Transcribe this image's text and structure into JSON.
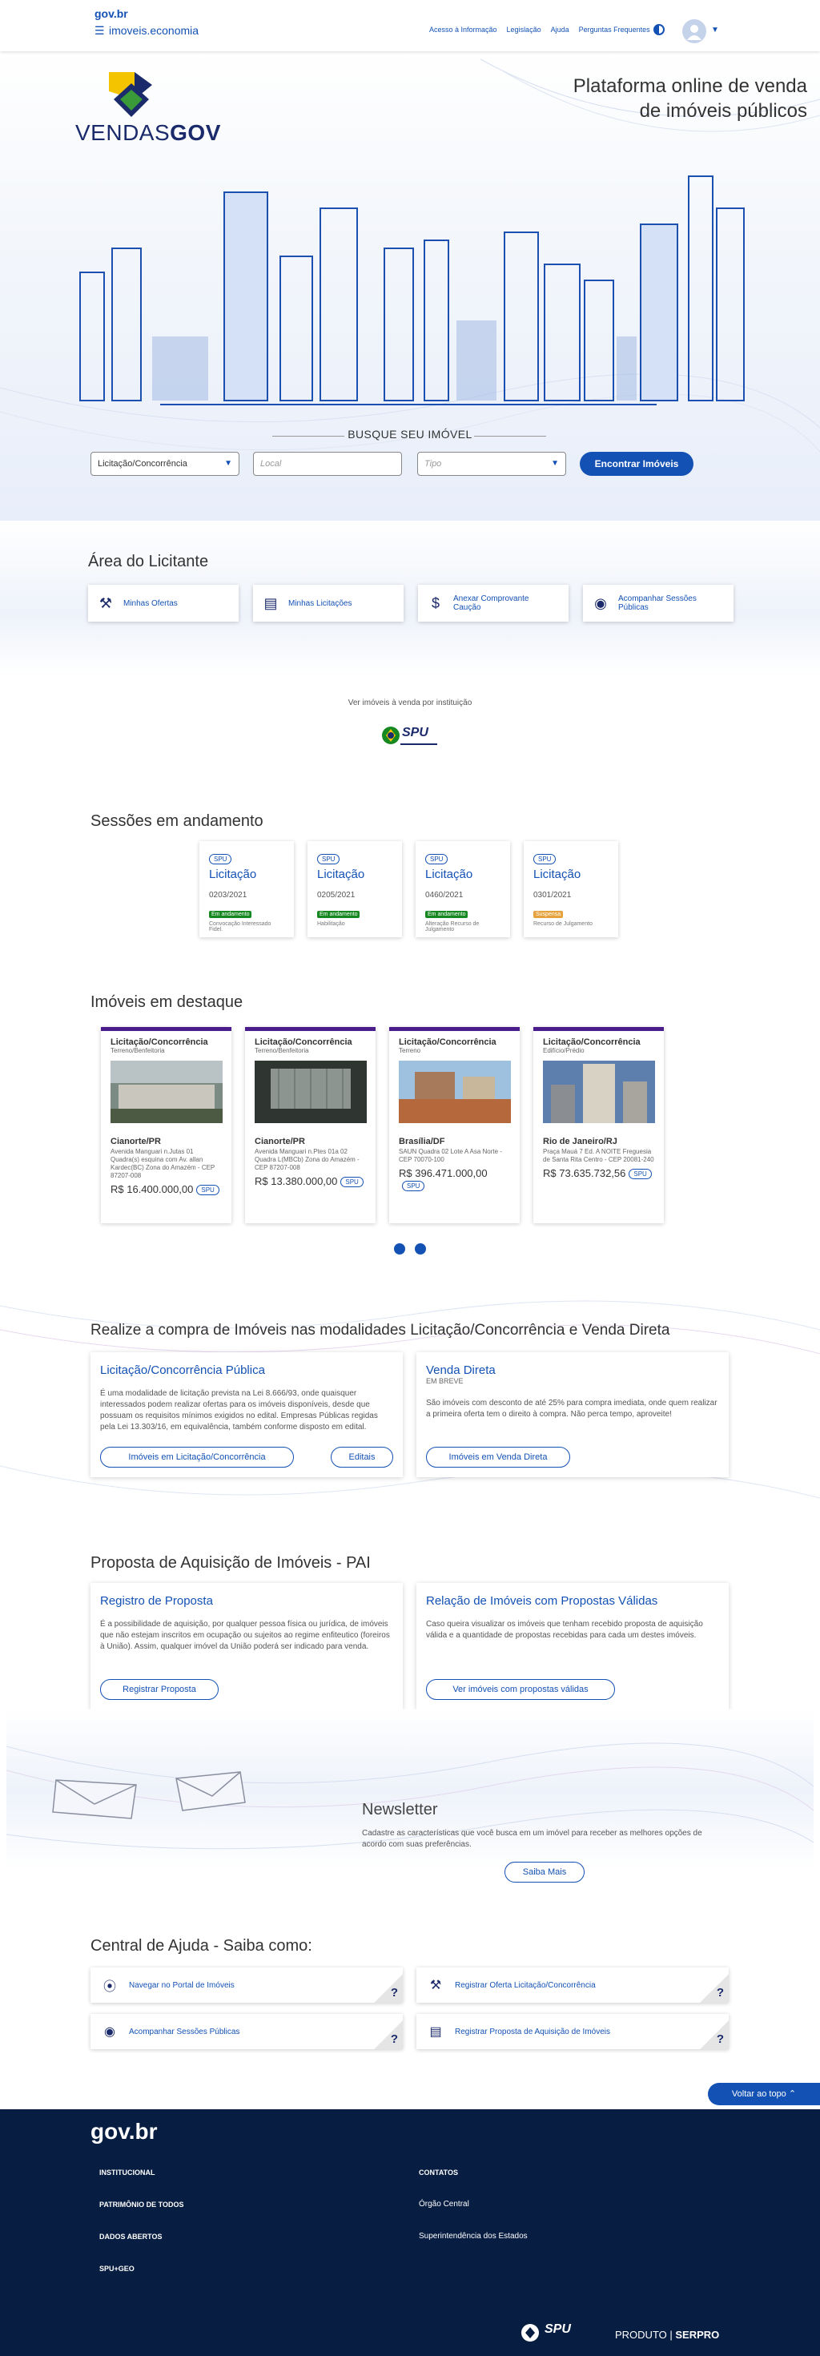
{
  "header": {
    "govbr": "gov.br",
    "site_name": "imoveis.economia",
    "links": [
      "Acesso à Informação",
      "Legislação",
      "Ajuda",
      "Perguntas Frequentes"
    ]
  },
  "hero": {
    "logo_text_1": "VENDAS",
    "logo_text_2": "GOV",
    "title_line1": "Plataforma online de venda",
    "title_line2": "de imóveis públicos"
  },
  "search": {
    "title": "BUSQUE SEU IMÓVEL",
    "modality_value": "Licitação/Concorrência",
    "local_placeholder": "Local",
    "type_placeholder": "Tipo",
    "button": "Encontrar Imóveis"
  },
  "licitante": {
    "title": "Área do Licitante",
    "items": [
      {
        "label": "Minhas Ofertas",
        "icon": "gavel-icon"
      },
      {
        "label": "Minhas Licitações",
        "icon": "clipboard-icon"
      },
      {
        "label": "Anexar Comprovante Caução",
        "icon": "invoice-icon"
      },
      {
        "label": "Acompanhar Sessões Públicas",
        "icon": "eye-icon"
      }
    ]
  },
  "institution": {
    "label": "Ver imóveis à venda por instituição",
    "logo": "SPU"
  },
  "sessions": {
    "title": "Sessões em andamento",
    "items": [
      {
        "org": "SPU",
        "type": "Licitação",
        "number": "0203/2021",
        "badge": "Em andamento",
        "badge_color": "#168821",
        "status": "Convocação Interessado Fidel."
      },
      {
        "org": "SPU",
        "type": "Licitação",
        "number": "0205/2021",
        "badge": "Em andamento",
        "badge_color": "#168821",
        "status": "Habilitação"
      },
      {
        "org": "SPU",
        "type": "Licitação",
        "number": "0460/2021",
        "badge": "Em andamento",
        "badge_color": "#168821",
        "status": "Alteração Recurso de Julgamento"
      },
      {
        "org": "SPU",
        "type": "Licitação",
        "number": "0301/2021",
        "badge": "Suspensa",
        "badge_color": "#e6a23c",
        "status": "Recurso de Julgamento"
      }
    ]
  },
  "featured": {
    "title": "Imóveis em destaque",
    "items": [
      {
        "modality": "Licitação/Concorrência",
        "type": "Terreno/Benfeitoria",
        "city": "Cianorte/PR",
        "address": "Avenida Manguari n.Jutas 01 Quadra(s) esquina com Av. allan Kardec(BC) Zona do Amazém - CEP 87207-008",
        "price": "R$ 16.400.000,00",
        "org": "SPU"
      },
      {
        "modality": "Licitação/Concorrência",
        "type": "Terreno/Benfeitoria",
        "city": "Cianorte/PR",
        "address": "Avenida Manguari n.Ptes 01a 02 Quadra L(MBCb) Zona do Amazém - CEP 87207-008",
        "price": "R$ 13.380.000,00",
        "org": "SPU"
      },
      {
        "modality": "Licitação/Concorrência",
        "type": "Terreno",
        "city": "Brasília/DF",
        "address": "SAUN Quadra 02 Lote A Asa Norte - CEP 70070-100",
        "price": "R$ 396.471.000,00",
        "org": "SPU"
      },
      {
        "modality": "Licitação/Concorrência",
        "type": "Edifício/Prédio",
        "city": "Rio de Janeiro/RJ",
        "address": "Praça Mauá 7 Ed. A NOITE Freguesia de Santa Rita Centro - CEP 20081-240",
        "price": "R$ 73.635.732,56",
        "org": "SPU"
      }
    ]
  },
  "modalities": {
    "title": "Realize a compra de Imóveis nas modalidades Licitação/Concorrência e Venda Direta",
    "licitacao": {
      "title": "Licitação/Concorrência Pública",
      "text": "É uma modalidade de licitação prevista na Lei 8.666/93, onde quaisquer interessados podem realizar ofertas para os imóveis disponíveis, desde que possuam os requisitos mínimos exigidos no edital. Empresas Públicas regidas pela Lei 13.303/16, em equivalência, também conforme disposto em edital.",
      "button": "Imóveis em Licitação/Concorrência",
      "button2": "Editais"
    },
    "venda": {
      "title": "Venda Direta",
      "subtitle": "EM BREVE",
      "text": "São imóveis com desconto de até 25% para compra imediata, onde quem realizar a primeira oferta tem o direito à compra. Não perca tempo, aproveite!",
      "button": "Imóveis em Venda Direta"
    }
  },
  "pai": {
    "title": "Proposta de Aquisição de Imóveis - PAI",
    "registro": {
      "title": "Registro de Proposta",
      "text": "É a possibilidade de aquisição, por qualquer pessoa física ou jurídica, de imóveis que não estejam inscritos em ocupação ou sujeitos ao regime enfiteutico (foreiros à União). Assim, qualquer imóvel da União poderá ser indicado para venda.",
      "button": "Registrar Proposta"
    },
    "relacao": {
      "title": "Relação de Imóveis com Propostas Válidas",
      "text": "Caso queira visualizar os imóveis que tenham recebido proposta de aquisição válida e a quantidade de propostas recebidas para cada um destes imóveis.",
      "button": "Ver imóveis com propostas válidas"
    }
  },
  "newsletter": {
    "title": "Newsletter",
    "text": "Cadastre as características que você busca em um imóvel para receber as melhores opções de acordo com suas preferências.",
    "button": "Saiba Mais"
  },
  "help": {
    "title": "Central de Ajuda - Saiba como:",
    "items": [
      {
        "label": "Navegar no Portal de Imóveis",
        "icon": "compass-icon"
      },
      {
        "label": "Registrar Oferta Licitação/Concorrência",
        "icon": "gavel-icon"
      },
      {
        "label": "Acompanhar Sessões Públicas",
        "icon": "eye-icon"
      },
      {
        "label": "Registrar Proposta de Aquisição de Imóveis",
        "icon": "document-icon"
      }
    ],
    "q": "?"
  },
  "back_to_top": "Voltar ao topo",
  "footer": {
    "logo": "gov.br",
    "left_links": [
      "INSTITUCIONAL",
      "PATRIMÔNIO DE TODOS",
      "DADOS ABERTOS",
      "SPU+GEO"
    ],
    "right_title": "CONTATOS",
    "right_links": [
      "Órgão Central",
      "Superintendência dos Estados"
    ],
    "spu": "SPU",
    "produto": "PRODUTO",
    "serpro": "SERPRO"
  }
}
